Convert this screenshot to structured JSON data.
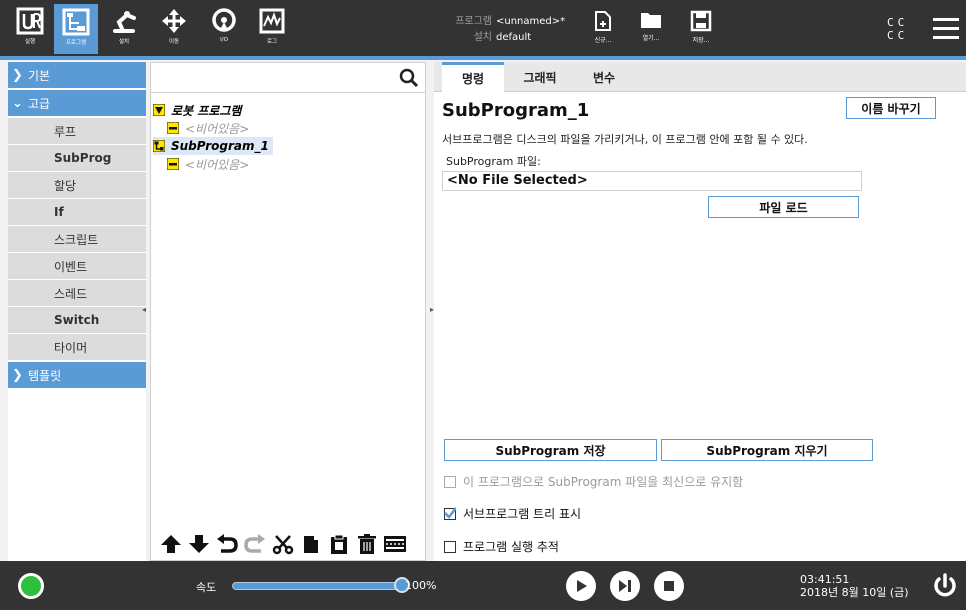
{
  "header": {
    "nav": [
      {
        "label": "실행",
        "icon": "ur-logo-icon"
      },
      {
        "label": "프로그램",
        "icon": "program-icon"
      },
      {
        "label": "설치",
        "icon": "installation-icon"
      },
      {
        "label": "이동",
        "icon": "move-icon"
      },
      {
        "label": "I/O",
        "icon": "io-icon"
      },
      {
        "label": "로그",
        "icon": "log-icon"
      }
    ],
    "program_key": "프로그램",
    "program_value": "<unnamed>*",
    "install_key": "설치",
    "install_value": "default",
    "file_buttons": [
      {
        "label": "신규...",
        "icon": "new-file-icon"
      },
      {
        "label": "열기...",
        "icon": "open-folder-icon"
      },
      {
        "label": "저장...",
        "icon": "save-icon"
      }
    ],
    "cc_top": "CC",
    "cc_bottom": "CC"
  },
  "categories": {
    "basic": "기본",
    "advanced": "고급",
    "advanced_items": [
      {
        "label": "루프",
        "bold": false
      },
      {
        "label": "SubProg",
        "bold": true
      },
      {
        "label": "할당",
        "bold": false
      },
      {
        "label": "If",
        "bold": true
      },
      {
        "label": "스크립트",
        "bold": false
      },
      {
        "label": "이벤트",
        "bold": false
      },
      {
        "label": "스레드",
        "bold": false
      },
      {
        "label": "Switch",
        "bold": true
      },
      {
        "label": "타이머",
        "bold": false
      }
    ],
    "templates": "템플릿"
  },
  "tree": {
    "search_placeholder": "",
    "root": "로봇 프로그램",
    "empty1": "<비어있음>",
    "subprogram": "SubProgram_1",
    "empty2": "<비어있음>"
  },
  "command": {
    "tabs": [
      "명령",
      "그래픽",
      "변수"
    ],
    "title": "SubProgram_1",
    "rename_label": "이름 바꾸기",
    "description": "서브프로그램은 디스크의 파일을 가리키거나, 이 프로그램 안에 포함 될 수 있다.",
    "file_label": "SubProgram 파일:",
    "file_value": "<No File Selected>",
    "load_label": "파일 로드",
    "save_label": "SubProgram 저장",
    "clear_label": "SubProgram 지우기",
    "keep_updated_label": "이 프로그램으로 SubProgram 파일을 최신으로 유지함",
    "keep_updated_checked": false,
    "show_tree_label": "서브프로그램 트리 표시",
    "show_tree_checked": true,
    "track_label": "프로그램 실행 추적",
    "track_checked": false
  },
  "footer": {
    "speed_label": "속도",
    "speed_value": "100%",
    "speed_fraction": 1.0,
    "time": "03:41:51",
    "date": "2018년 8월 10일 (금)"
  },
  "colors": {
    "accent": "#5b9bd5",
    "header_bg": "#333333",
    "status_green": "#2fbf3f",
    "tree_yellow": "#ffe600"
  }
}
